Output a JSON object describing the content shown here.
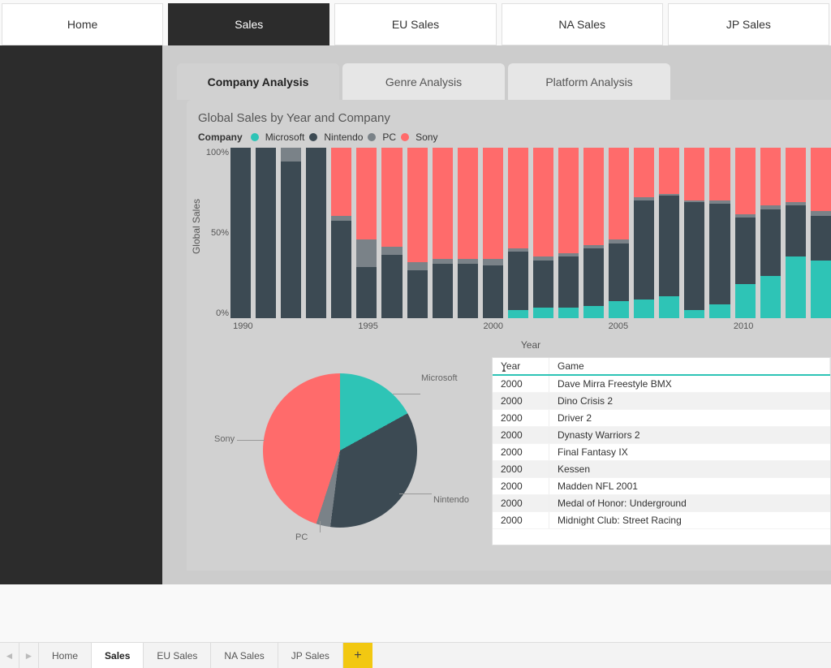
{
  "nav": {
    "tabs": [
      {
        "label": "Home",
        "active": false
      },
      {
        "label": "Sales",
        "active": true
      },
      {
        "label": "EU Sales",
        "active": false
      },
      {
        "label": "NA Sales",
        "active": false
      },
      {
        "label": "JP Sales",
        "active": false
      }
    ]
  },
  "subtabs": [
    {
      "label": "Company Analysis",
      "active": true
    },
    {
      "label": "Genre Analysis",
      "active": false
    },
    {
      "label": "Platform Analysis",
      "active": false
    }
  ],
  "chart_data": [
    {
      "type": "bar",
      "stacked": true,
      "normalized": "100%",
      "title": "Global Sales by Year and Company",
      "ylabel": "Global Sales",
      "xlabel": "Year",
      "ylim": [
        0,
        100
      ],
      "yticks": [
        "0%",
        "50%",
        "100%"
      ],
      "xticks": [
        1990,
        1995,
        2000,
        2005,
        2010
      ],
      "legend_title": "Company",
      "categories": [
        1990,
        1991,
        1992,
        1993,
        1994,
        1995,
        1996,
        1997,
        1998,
        1999,
        2000,
        2001,
        2002,
        2003,
        2004,
        2005,
        2006,
        2007,
        2008,
        2009,
        2010,
        2011,
        2012,
        2013
      ],
      "series": [
        {
          "name": "Microsoft",
          "color": "#2ec4b6",
          "values": [
            0,
            0,
            0,
            0,
            0,
            0,
            0,
            0,
            0,
            0,
            0,
            5,
            6,
            6,
            7,
            10,
            11,
            13,
            5,
            8,
            20,
            25,
            36,
            34
          ]
        },
        {
          "name": "Nintendo",
          "color": "#3c4a53",
          "values": [
            100,
            100,
            92,
            100,
            57,
            30,
            37,
            28,
            32,
            32,
            31,
            34,
            28,
            30,
            34,
            34,
            58,
            59,
            63,
            59,
            39,
            39,
            30,
            26
          ]
        },
        {
          "name": "PC",
          "color": "#7a8288",
          "values": [
            0,
            0,
            8,
            0,
            3,
            16,
            5,
            5,
            3,
            3,
            4,
            2,
            2,
            2,
            2,
            2,
            2,
            1,
            1,
            2,
            2,
            2,
            2,
            3
          ]
        },
        {
          "name": "Sony",
          "color": "#ff6b6b",
          "values": [
            0,
            0,
            0,
            0,
            40,
            54,
            58,
            67,
            65,
            65,
            65,
            59,
            64,
            62,
            57,
            54,
            29,
            27,
            31,
            31,
            39,
            34,
            32,
            37
          ]
        }
      ]
    },
    {
      "type": "pie",
      "title": "",
      "series": [
        {
          "name": "Microsoft",
          "color": "#2ec4b6",
          "value": 17
        },
        {
          "name": "Nintendo",
          "color": "#3c4a53",
          "value": 35
        },
        {
          "name": "PC",
          "color": "#7a8288",
          "value": 3
        },
        {
          "name": "Sony",
          "color": "#ff6b6b",
          "value": 45
        }
      ]
    }
  ],
  "table": {
    "columns": [
      "Year",
      "Game"
    ],
    "sort_column": "Year",
    "sort_dir": "asc",
    "rows": [
      {
        "year": 2000,
        "game": "Dave Mirra Freestyle BMX"
      },
      {
        "year": 2000,
        "game": "Dino Crisis 2"
      },
      {
        "year": 2000,
        "game": "Driver 2"
      },
      {
        "year": 2000,
        "game": "Dynasty Warriors 2"
      },
      {
        "year": 2000,
        "game": "Final Fantasy IX"
      },
      {
        "year": 2000,
        "game": "Kessen"
      },
      {
        "year": 2000,
        "game": "Madden NFL 2001"
      },
      {
        "year": 2000,
        "game": "Medal of Honor: Underground"
      },
      {
        "year": 2000,
        "game": "Midnight Club: Street Racing"
      }
    ]
  },
  "page_tabs": {
    "tabs": [
      {
        "label": "Home",
        "active": false
      },
      {
        "label": "Sales",
        "active": true
      },
      {
        "label": "EU Sales",
        "active": false
      },
      {
        "label": "NA Sales",
        "active": false
      },
      {
        "label": "JP Sales",
        "active": false
      }
    ],
    "add_label": "+"
  },
  "more_menu": "⋯"
}
